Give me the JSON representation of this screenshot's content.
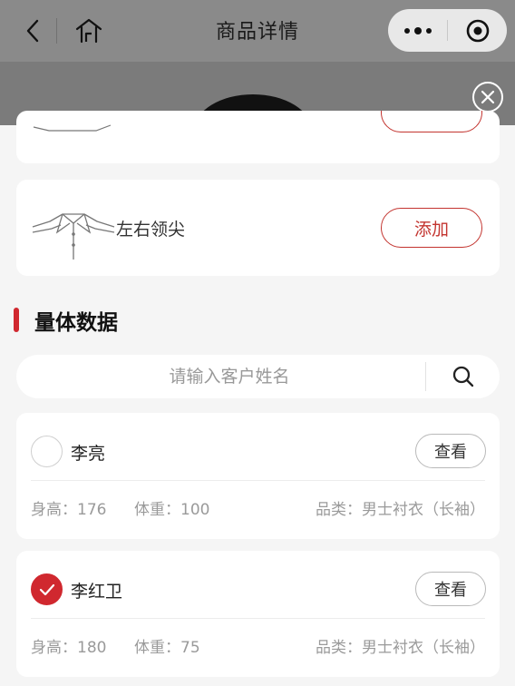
{
  "nav": {
    "title": "商品详情"
  },
  "collar": {
    "label": "左右领尖",
    "add_label": "添加"
  },
  "section": {
    "title": "量体数据"
  },
  "search": {
    "placeholder": "请输入客户姓名",
    "value": ""
  },
  "customers": [
    {
      "name": "李亮",
      "checked": false,
      "view_label": "查看",
      "height": "身高：176",
      "weight": "体重：100",
      "category": "品类：男士衬衣（长袖）"
    },
    {
      "name": "李红卫",
      "checked": true,
      "view_label": "查看",
      "height": "身高：180",
      "weight": "体重：75",
      "category": "品类：男士衬衣（长袖）"
    }
  ],
  "colors": {
    "accent": "#d0282f",
    "navbar": "#8a8a8a"
  }
}
